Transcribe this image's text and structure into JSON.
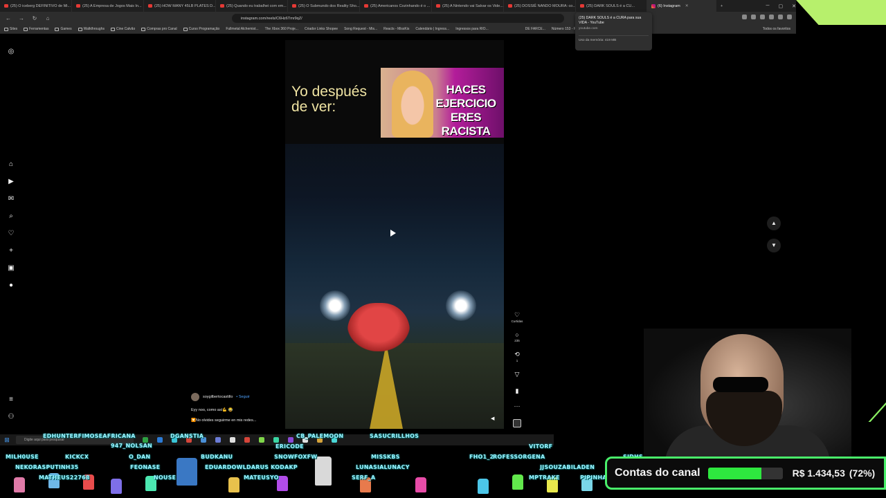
{
  "browser": {
    "tabs": [
      {
        "label": "(25) O iceberg DEFINITIVO de Mi...",
        "type": "yt"
      },
      {
        "label": "(25) A Empresa de Jogos Mais In...",
        "type": "yt"
      },
      {
        "label": "(25) HOW MANY 45LB PLATES D...",
        "type": "yt"
      },
      {
        "label": "(25) Quando eu trabalhei com em...",
        "type": "yt"
      },
      {
        "label": "(25) O Submundo dos Reality Sho...",
        "type": "yt"
      },
      {
        "label": "(25) Americanos Cozinhando é o ...",
        "type": "yt"
      },
      {
        "label": "(25) A Nintendo vai Salvar os Vide...",
        "type": "yt"
      },
      {
        "label": "(25) DOSSIÊ NANDO MOURA: co...",
        "type": "yt"
      },
      {
        "label": "(25) DARK SOULS é a CU...",
        "type": "yt"
      },
      {
        "label": "(6) Instagram",
        "type": "ig"
      }
    ],
    "url": "instagram.com/reels/C6Hz6Tmr9qZ/",
    "bookmarks": [
      "Sites",
      "Ferramentas",
      "Games",
      "Walkthroughs",
      "Cine Calvão",
      "Compras pro Canal",
      "Curso Programação",
      "Fullmetal Alchemist...",
      "The Xbox 360 Proje...",
      "Criador Links Shopee",
      "Song Request - Mis...",
      "Reacts - MissKis",
      "Calendário | Ingress...",
      "Ingressos para RIO...",
      "DE FARCE...",
      "Número 153 - Planit..."
    ],
    "bookmarks_right": "Todos os favoritos",
    "hover_card": {
      "title": "(25) DARK SOULS é a CURA para sua VIDA - YouTube",
      "domain": "youtube.com",
      "memory": "Uso da memória: 419 MB"
    }
  },
  "reel": {
    "caption_line1": "Yo después",
    "caption_line2": "de ver:",
    "thumbnail_text": "HACES EJERCICIO ERES RACISTA",
    "username": "soygilbertocastillo",
    "follow_label": "• Seguir",
    "description": "Eyy noo, como así💪 😂",
    "description2": "🔽No olvides seguirme en mis redes...",
    "likes_label": "Curtidas",
    "comments_count": "235",
    "reposts_count": "1"
  },
  "taskbar": {
    "search_placeholder": "Digite aqui para pesquisar"
  },
  "overlay": {
    "chatters": [
      "EDHUNTERFIMOSEAFRICANA",
      "947_NOLSAN",
      "DGANSTIA",
      "CB_PALEMOON",
      "SASUCRILLHOS",
      "ERICODE",
      "VITORF",
      "MILH0USE",
      "KICKCX",
      "O_DAN",
      "BUDKANU",
      "SNOWFOXFW",
      "MISSKBS",
      "FHO1_2",
      "ROFESSORGENA",
      "NEKORASPUTINH35",
      "FEONASE",
      "EDUARDOWLDARUS KODAKP",
      "LUNASIALUNACY",
      "JJSOUZABILADEN",
      "MATHEUS22768",
      "NOUSE",
      "MATEUSYO",
      "SERF_A",
      "MPTRAKE",
      "PIPINHA",
      "SJDHS"
    ],
    "goal_label": "Contas do canal",
    "goal_amount": "R$ 1.434,53",
    "goal_percent_text": "(72%)",
    "goal_fraction": 0.72,
    "accent_color": "#2ee83f"
  }
}
